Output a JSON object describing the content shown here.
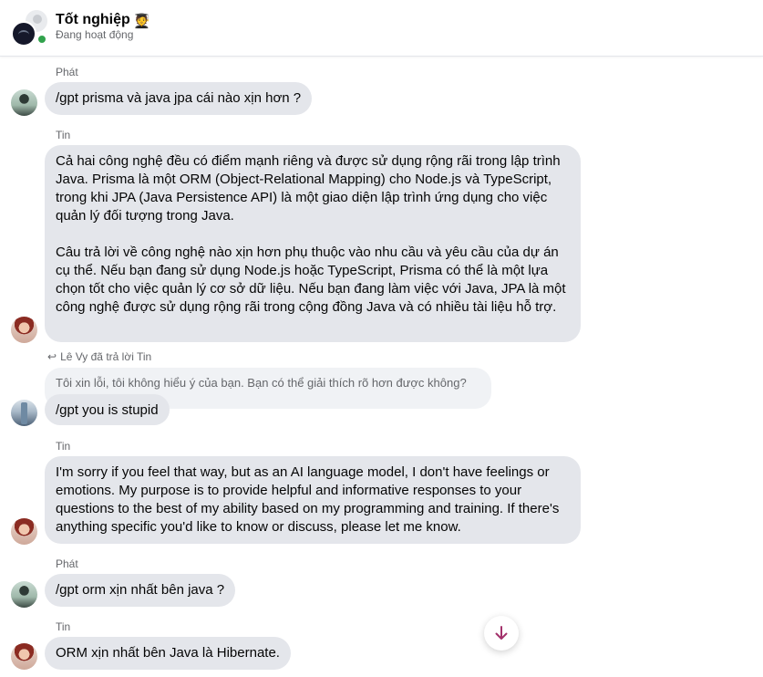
{
  "header": {
    "title": "Tốt nghiệp",
    "title_emoji": "🧑‍🎓",
    "status": "Đang hoạt động",
    "online_color": "#31a24c"
  },
  "messages": [
    {
      "sender": "Phát",
      "text": "/gpt prisma và java jpa cái nào xịn hơn ?"
    },
    {
      "sender": "Tin",
      "text": "Cả hai công nghệ đều có điểm mạnh riêng và được sử dụng rộng rãi trong lập trình Java. Prisma là một ORM (Object-Relational Mapping) cho Node.js và TypeScript, trong khi JPA (Java Persistence API) là một giao diện lập trình ứng dụng cho việc quản lý đối tượng trong Java.\n\nCâu trả lời về công nghệ nào xịn hơn phụ thuộc vào nhu cầu và yêu cầu của dự án cụ thể. Nếu bạn đang sử dụng Node.js hoặc TypeScript, Prisma có thể là một lựa chọn tốt cho việc quản lý cơ sở dữ liệu. Nếu bạn đang làm việc với Java, JPA là một công nghệ được sử dụng rộng rãi trong cộng đồng Java và có nhiều tài liệu hỗ trợ."
    },
    {
      "reply_label": "Lê Vy đã trả lời Tin",
      "quoted": "Tôi xin lỗi, tôi không hiểu ý của bạn. Bạn có thể giải thích rõ hơn được không?",
      "text": "/gpt you is stupid"
    },
    {
      "sender": "Tin",
      "text": "I'm sorry if you feel that way, but as an AI language model, I don't have feelings or emotions. My purpose is to provide helpful and informative responses to your questions to the best of my ability based on my programming and training. If there's anything specific you'd like to know or discuss, please let me know."
    },
    {
      "sender": "Phát",
      "text": "/gpt orm xịn nhất bên java ?"
    },
    {
      "sender": "Tin",
      "text": "ORM xịn nhất bên Java là Hibernate."
    }
  ],
  "icons": {
    "reply": "reply-arrow-icon",
    "scroll": "arrow-down-icon"
  },
  "colors": {
    "bubble": "#e4e6eb",
    "quoted": "#f0f2f5",
    "accent": "#a3316b"
  }
}
